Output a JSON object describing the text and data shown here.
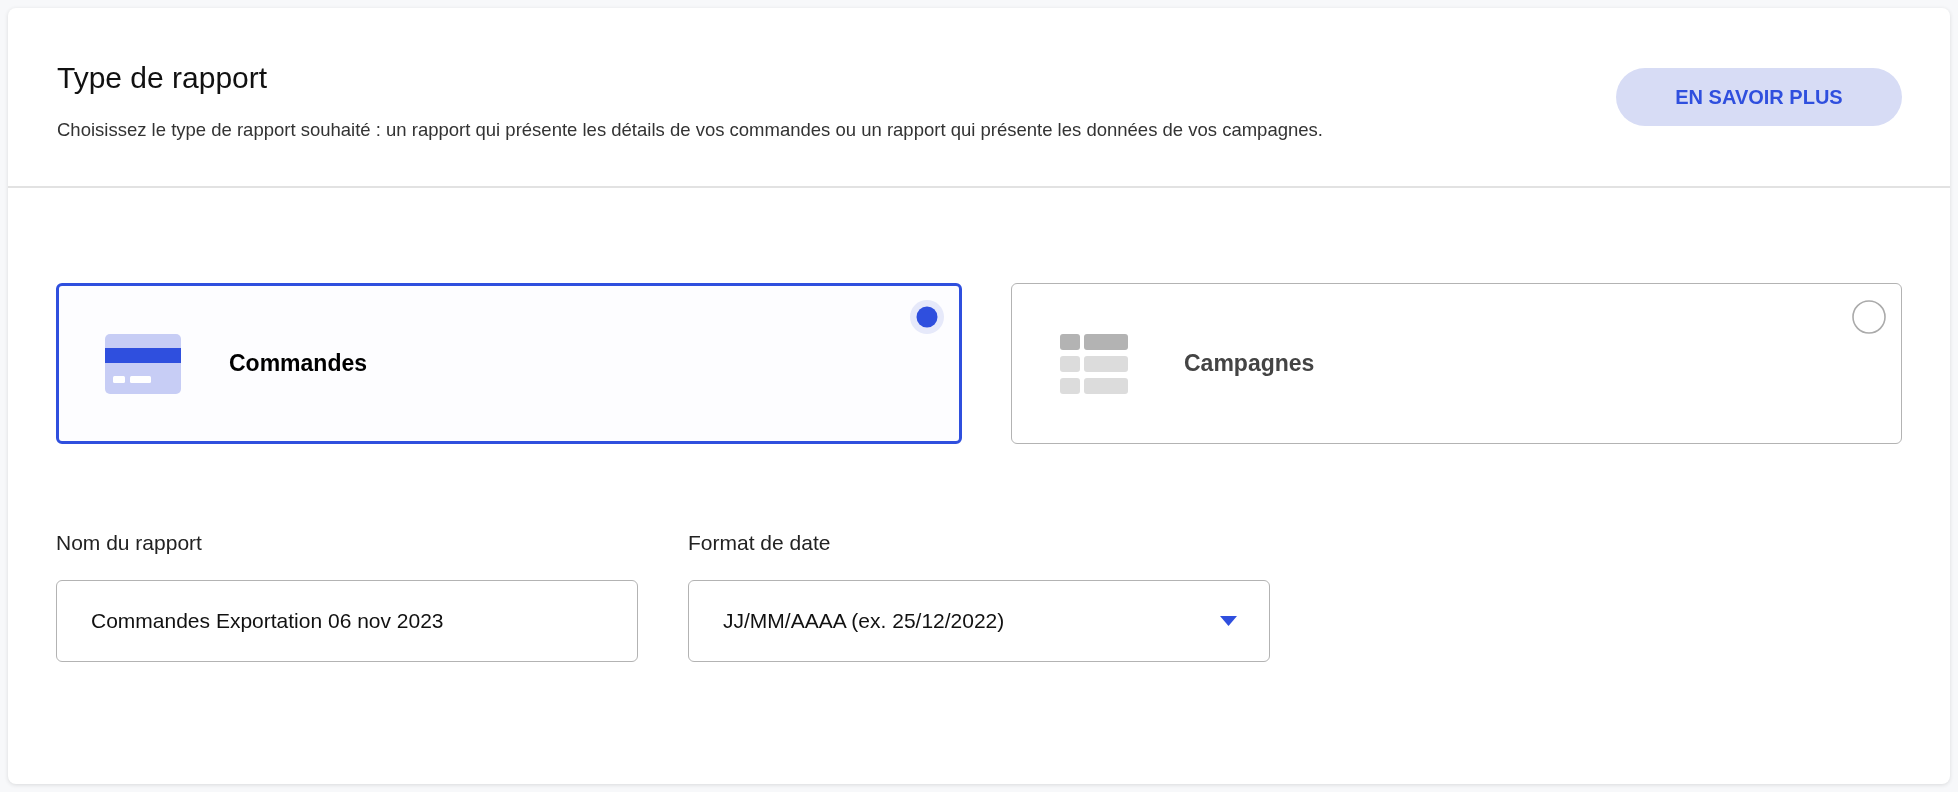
{
  "header": {
    "title": "Type de rapport",
    "description": "Choisissez le type de rapport souhaité : un rapport qui présente les détails de vos commandes ou un rapport qui présente les données de vos campagnes.",
    "learn_more_button": "EN SAVOIR PLUS"
  },
  "report_types": [
    {
      "kind": "orders",
      "label": "Commandes",
      "selected": true
    },
    {
      "kind": "campaigns",
      "label": "Campagnes",
      "selected": false
    }
  ],
  "fields": [
    {
      "kind": "text",
      "label": "Nom du rapport",
      "value": "Commandes Exportation 06 nov 2023"
    },
    {
      "kind": "select",
      "label": "Format de date",
      "value": "JJ/MM/AAAA (ex. 25/12/2022)"
    }
  ]
}
